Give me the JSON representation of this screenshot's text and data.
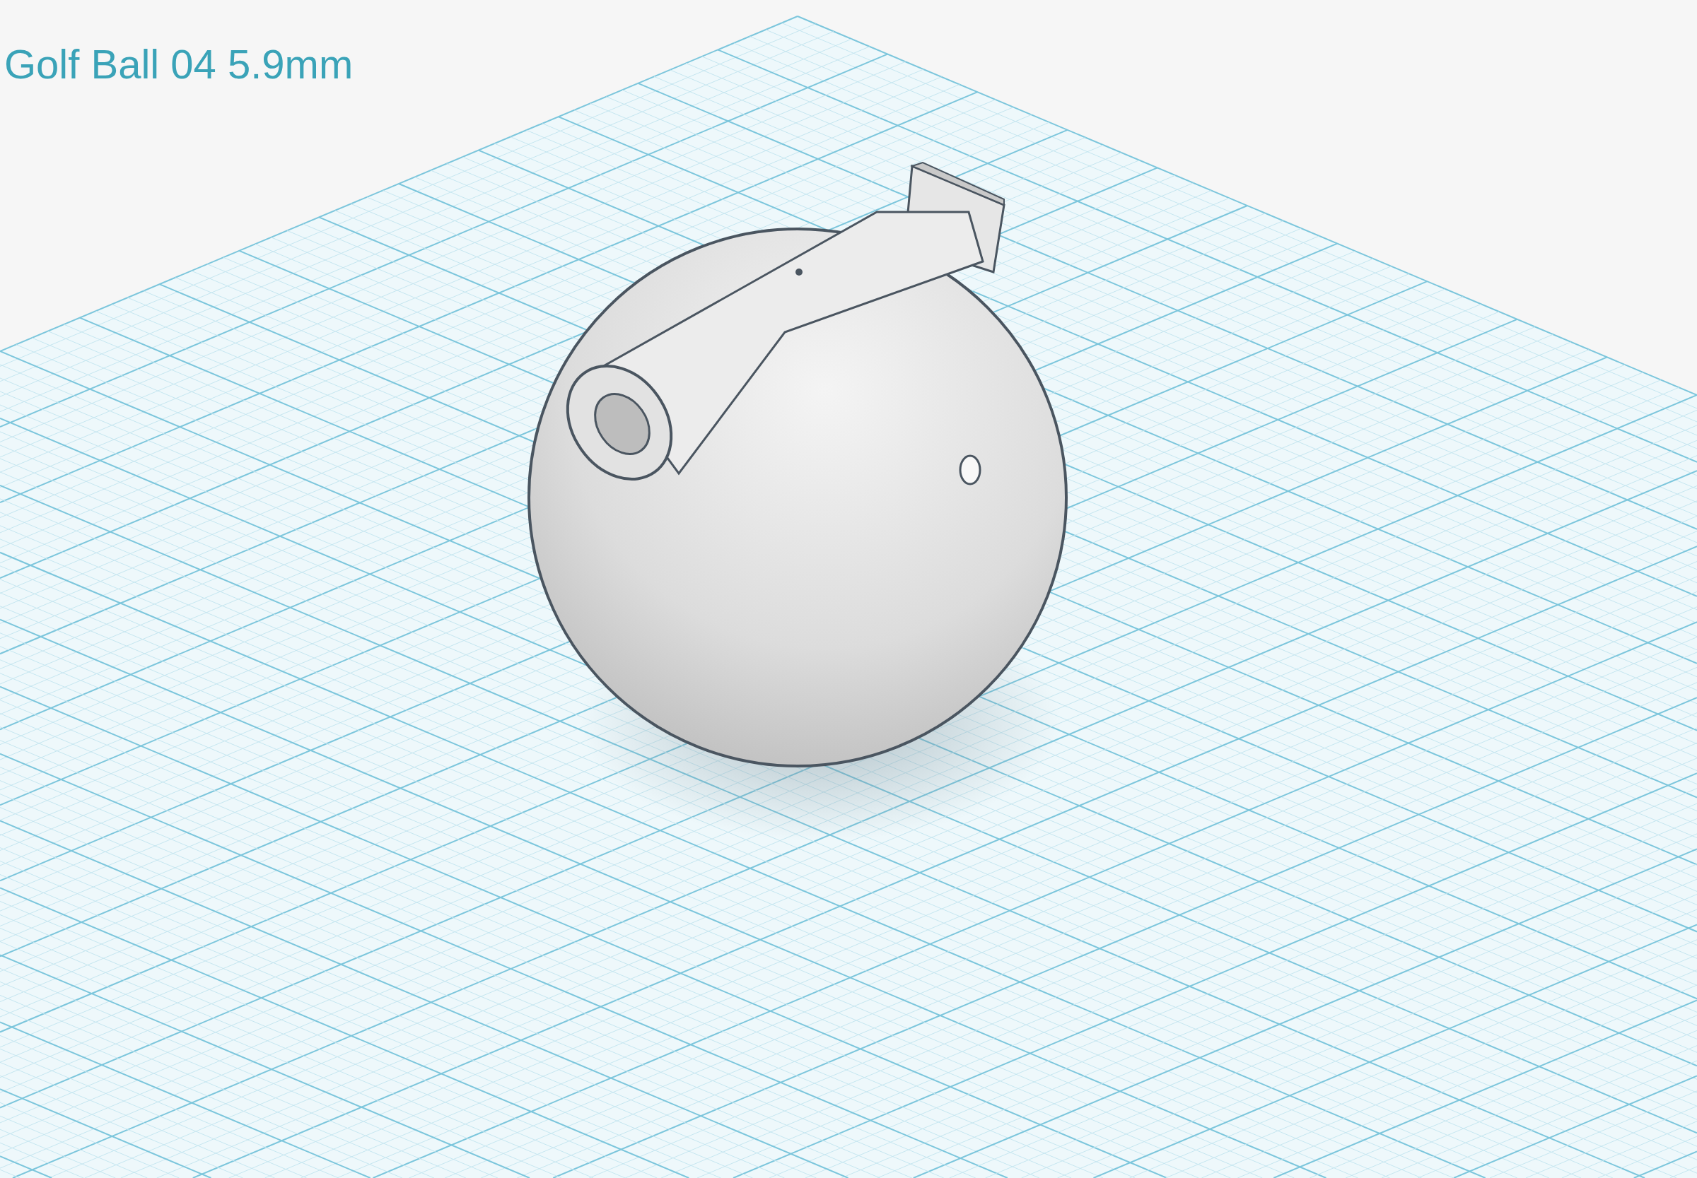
{
  "design_title": "Golf Ball 04 5.9mm"
}
